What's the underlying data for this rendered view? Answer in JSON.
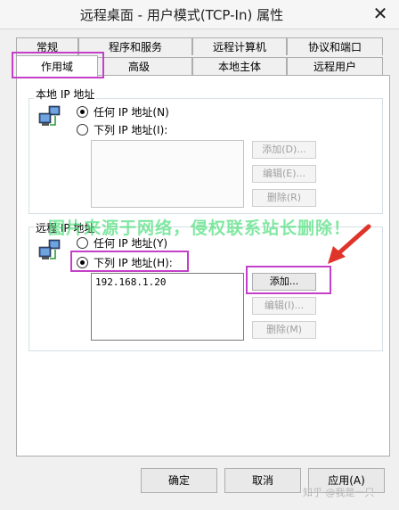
{
  "window": {
    "title": "远程桌面 - 用户模式(TCP-In) 属性",
    "close_glyph": "✕"
  },
  "tabs_row1": [
    "常规",
    "程序和服务",
    "远程计算机",
    "协议和端口"
  ],
  "tabs_row2": [
    "作用域",
    "高级",
    "本地主体",
    "远程用户"
  ],
  "local_ip": {
    "label": "本地 IP 地址",
    "any_option": "任何 IP 地址(N)",
    "list_option": "下列 IP 地址(I):",
    "add": "添加(D)...",
    "edit": "编辑(E)...",
    "remove": "删除(R)"
  },
  "remote_ip": {
    "label": "远程 IP 地址",
    "any_option": "任何 IP 地址(Y)",
    "list_option": "下列 IP 地址(H):",
    "items": [
      "192.168.1.20"
    ],
    "add": "添加...",
    "edit": "编辑(I)...",
    "remove": "删除(M)"
  },
  "watermark": "图片来源于网络，侵权联系站长删除！",
  "footer": {
    "ok": "确定",
    "cancel": "取消",
    "apply": "应用(A)"
  },
  "zhihu_watermark": "知乎 @我是一只",
  "colors": {
    "highlight": "#c341c8",
    "arrow": "#e0342b"
  }
}
